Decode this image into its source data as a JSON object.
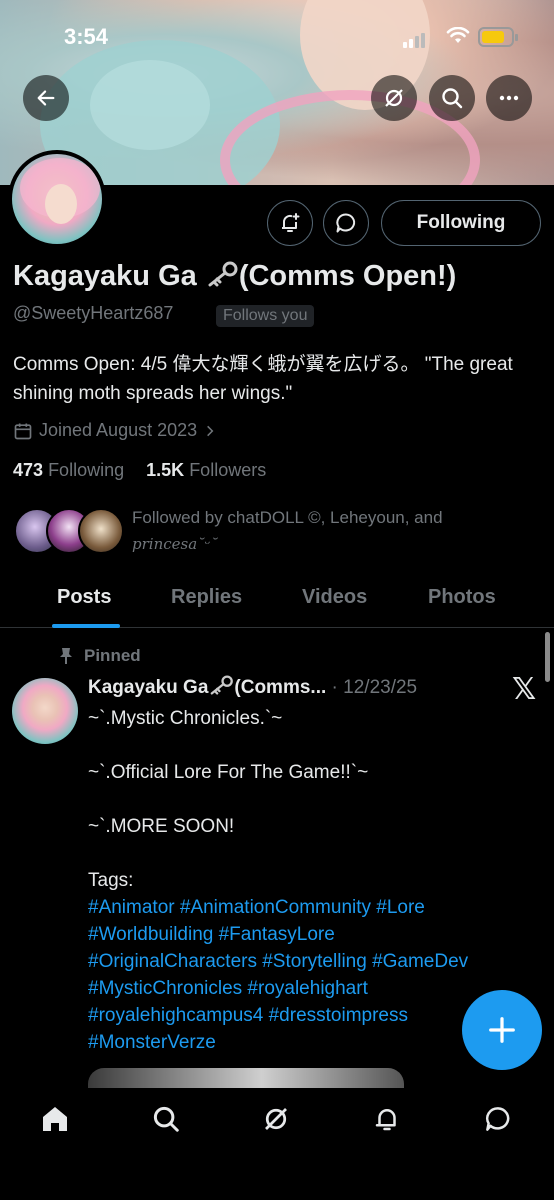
{
  "status_bar": {
    "time": "3:54"
  },
  "profile": {
    "name": "Kagayaku Ga",
    "name_suffix": "(Comms Open!)",
    "handle": "@SweetyHeartz687",
    "follows_you": "Follows you",
    "bio": "Comms Open: 4/5 偉大な輝く蛾が翼を広げる。 \"The great shining moth spreads her wings.\"",
    "joined": "Joined August 2023",
    "following_count": "473",
    "following_label": "Following",
    "followers_count": "1.5K",
    "followers_label": "Followers",
    "followed_by": "Followed by chatDOLL ©, Leheyoun, and",
    "followed_by_last": "princesa˘ᵕ˘"
  },
  "actions": {
    "follow_button": "Following"
  },
  "tabs": [
    {
      "label": "Posts"
    },
    {
      "label": "Replies"
    },
    {
      "label": "Videos"
    },
    {
      "label": "Photos"
    }
  ],
  "post": {
    "pinned_label": "Pinned",
    "author": "Kagayaku Ga",
    "author_suffix": "(Comms...",
    "date": "· 12/23/25",
    "lines": [
      "~`.Mystic Chronicles.`~",
      "~`.Official Lore For The Game!!`~",
      "~`.MORE SOON!",
      "Tags:"
    ],
    "tag_lines": [
      "#Animator #AnimationCommunity #Lore",
      "#Worldbuilding #FantasyLore",
      "#OriginalCharacters #Storytelling #GameDev",
      "#MysticChronicles #royalehighart",
      "#royalehighcampus4 #dresstoimpress",
      "#MonsterVerze"
    ]
  },
  "icons": {
    "back": "arrow-left-icon",
    "grok": "grok-icon",
    "search": "search-icon",
    "more": "more-icon",
    "notify": "bell-plus-icon",
    "message": "message-icon",
    "calendar": "calendar-icon",
    "pin": "pin-icon",
    "x_logo": "x-logo-icon",
    "compose": "plus-icon",
    "nav": [
      "home-icon",
      "search-icon",
      "grok-icon",
      "bell-icon",
      "message-icon"
    ]
  },
  "colors": {
    "accent": "#1d9bf0",
    "muted": "#71767b",
    "text": "#e7e9ea",
    "background": "#000000"
  }
}
